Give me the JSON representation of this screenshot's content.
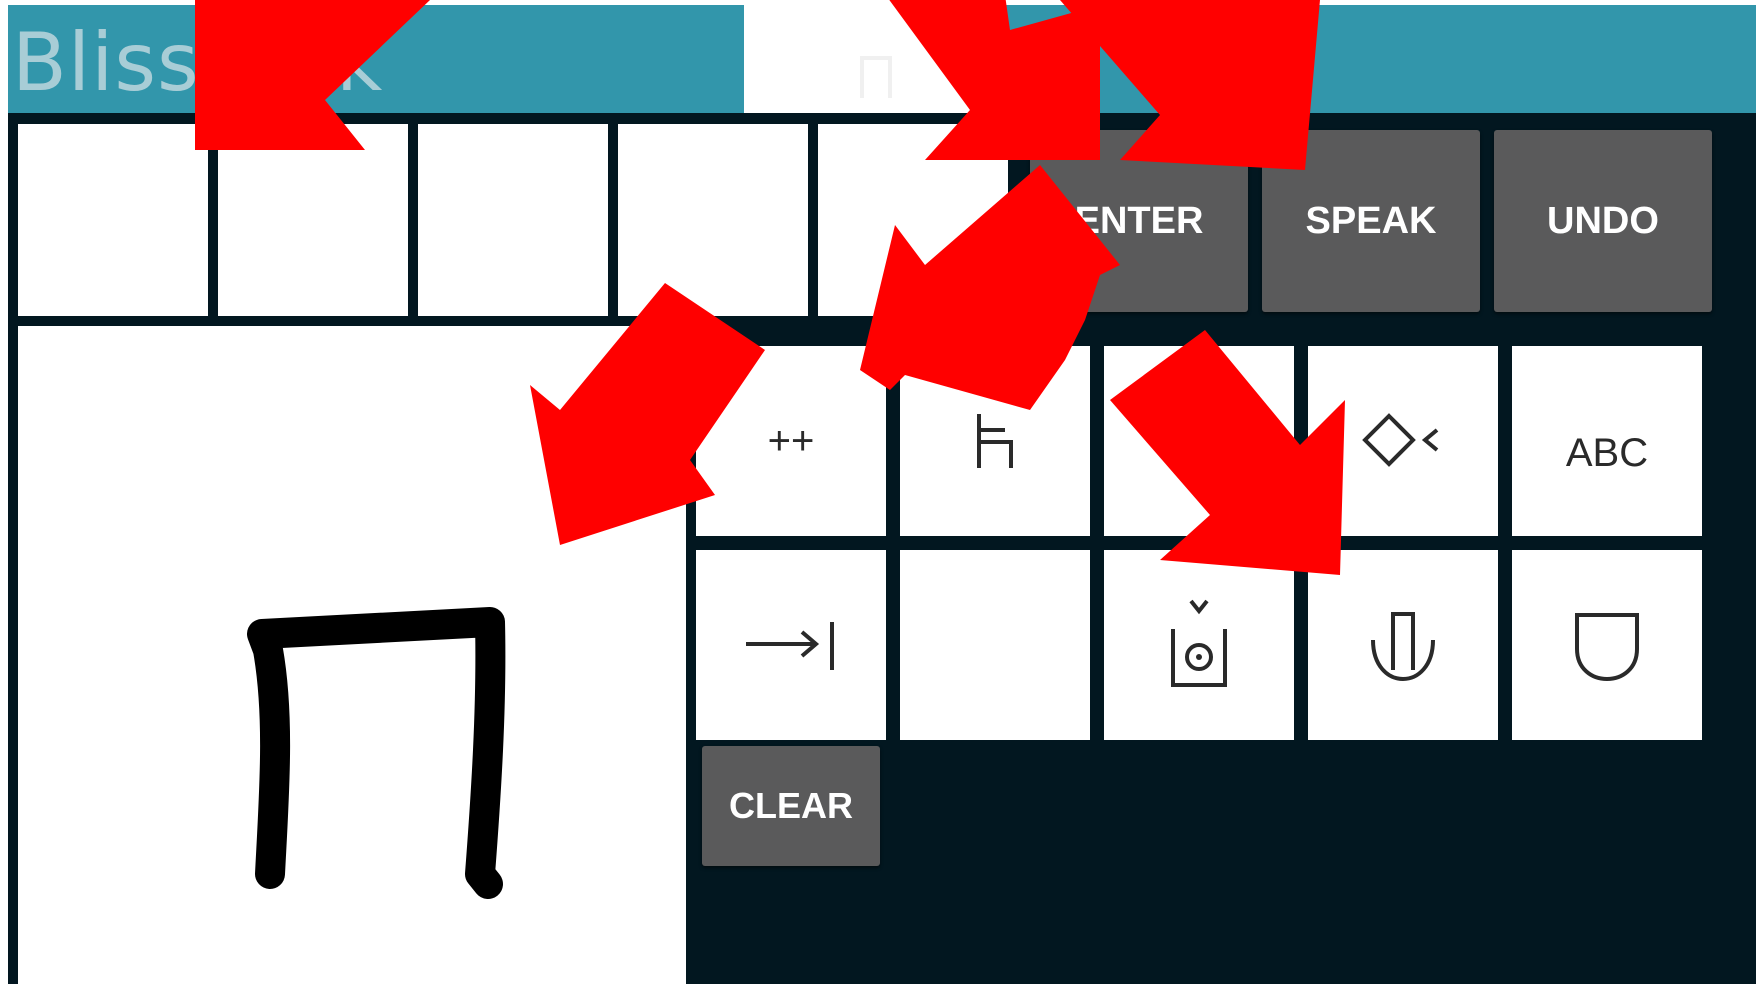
{
  "app": {
    "title": "Bliss Talk"
  },
  "sentence_strip": {
    "cells": [
      "",
      "",
      "",
      "",
      ""
    ]
  },
  "actions": {
    "enter_label": "ENTER",
    "speak_label": "SPEAK",
    "undo_label": "UNDO",
    "clear_label": "CLEAR"
  },
  "keyboard": {
    "keys": [
      {
        "label": "++",
        "icon": "plus-plus-icon"
      },
      {
        "label": "",
        "icon": "chair-icon"
      },
      {
        "label": "",
        "icon": "blank-icon"
      },
      {
        "label": "",
        "icon": "diamond-arrow-icon"
      },
      {
        "label": "ABC",
        "icon": "abc-text"
      },
      {
        "label": "",
        "icon": "arrow-to-bar-icon"
      },
      {
        "label": "",
        "icon": "blank-icon"
      },
      {
        "label": "",
        "icon": "sun-container-icon"
      },
      {
        "label": "",
        "icon": "mouth-tongue-icon"
      },
      {
        "label": "",
        "icon": "mouth-icon"
      }
    ]
  },
  "canvas": {
    "drawn_symbol": "handwritten-arch-stroke"
  },
  "colors": {
    "title_bar": "#3296ab",
    "title_text": "#a8cdd6",
    "background": "#021720",
    "button": "#5a5a5b",
    "button_text": "#ffffff",
    "key": "#ffffff",
    "overlay_arrow": "#ff0000"
  }
}
